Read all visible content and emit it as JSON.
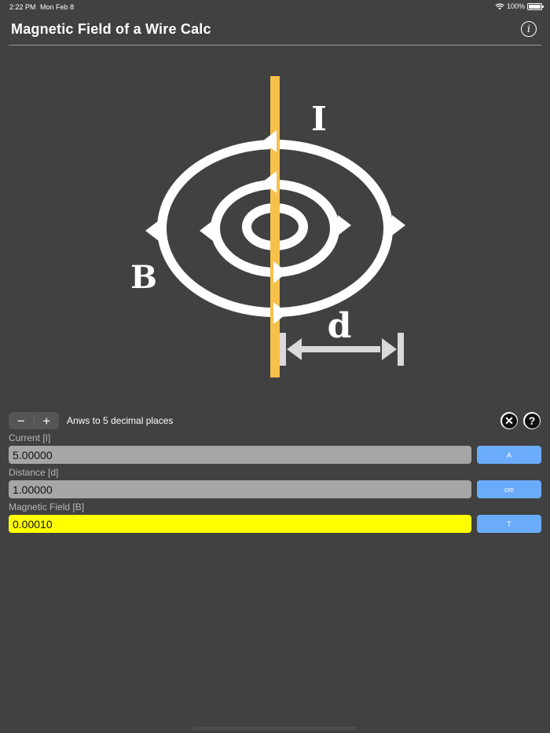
{
  "status_bar": {
    "time": "2:22 PM",
    "date": "Mon Feb 8",
    "battery": "100%"
  },
  "nav": {
    "title": "Magnetic Field of a Wire Calc",
    "info_icon": "info-circle-icon"
  },
  "diagram": {
    "current_label": "I",
    "field_label": "B",
    "distance_label": "d"
  },
  "controls": {
    "decrement_label": "−",
    "increment_label": "+",
    "decimals_text": "Anws to 5 decimal places",
    "clear_icon": "clear-icon",
    "help_icon": "help-icon"
  },
  "fields": [
    {
      "label": "Current [I]",
      "value": "5.00000",
      "unit": "A"
    },
    {
      "label": "Distance [d]",
      "value": "1.00000",
      "unit": "cm"
    },
    {
      "label": "Magnetic Field [B]",
      "value": "0.00010",
      "unit": "T"
    }
  ],
  "colors": {
    "background": "#414141",
    "wire": "#f7c04a",
    "field_lines": "#ffffff",
    "result_field": "#ffff00",
    "input_field": "#a6a6a6",
    "unit_button": "#6aacfa"
  }
}
